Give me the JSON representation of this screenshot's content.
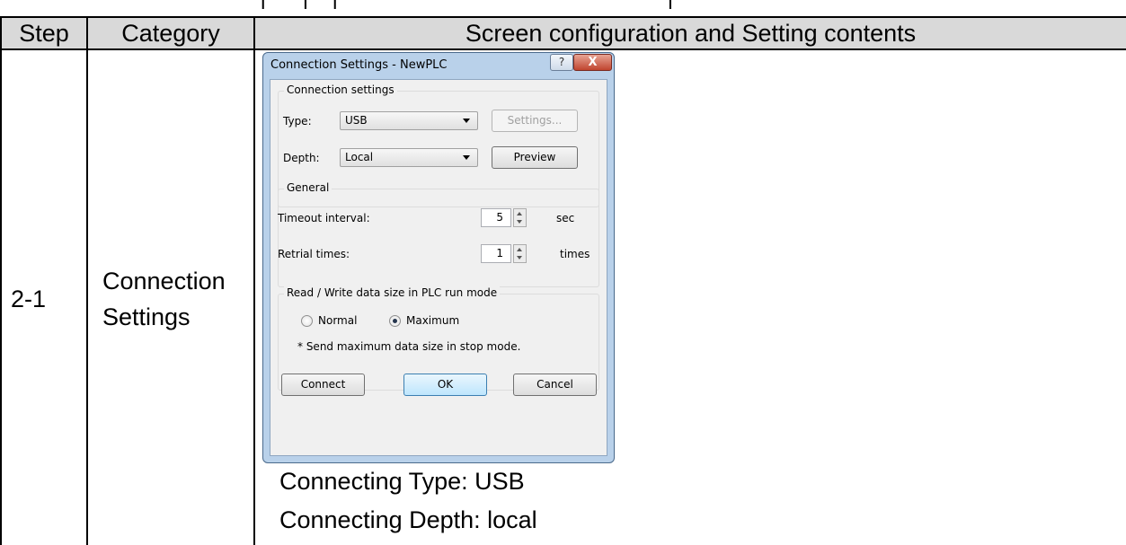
{
  "table": {
    "headers": {
      "step": "Step",
      "category": "Category",
      "content": "Screen configuration and Setting contents"
    },
    "row": {
      "step": "2-1",
      "category_line1": "Connection",
      "category_line2": "Settings",
      "notes": [
        "Connecting Type: USB",
        "Connecting Depth: local"
      ]
    }
  },
  "dialog": {
    "title": "Connection Settings - NewPLC",
    "help_glyph": "?",
    "close_glyph": "X",
    "connection_group": "Connection settings",
    "type_label": "Type:",
    "type_value": "USB",
    "settings_button": "Settings...",
    "depth_label": "Depth:",
    "depth_value": "Local",
    "preview_button": "Preview",
    "general_group": "General",
    "timeout_label": "Timeout interval:",
    "timeout_value": "5",
    "timeout_unit": "sec",
    "retrial_label": "Retrial times:",
    "retrial_value": "1",
    "retrial_unit": "times",
    "rw_group": "Read / Write data size in PLC run mode",
    "radio_normal": "Normal",
    "radio_maximum": "Maximum",
    "selected_radio": "Maximum",
    "note": "* Send maximum data size in stop mode.",
    "connect_button": "Connect",
    "ok_button": "OK",
    "cancel_button": "Cancel"
  },
  "colors": {
    "header_bg": "#d9d9d9",
    "window_frame": "#b9d1ea",
    "close_red": "#c0452f"
  }
}
